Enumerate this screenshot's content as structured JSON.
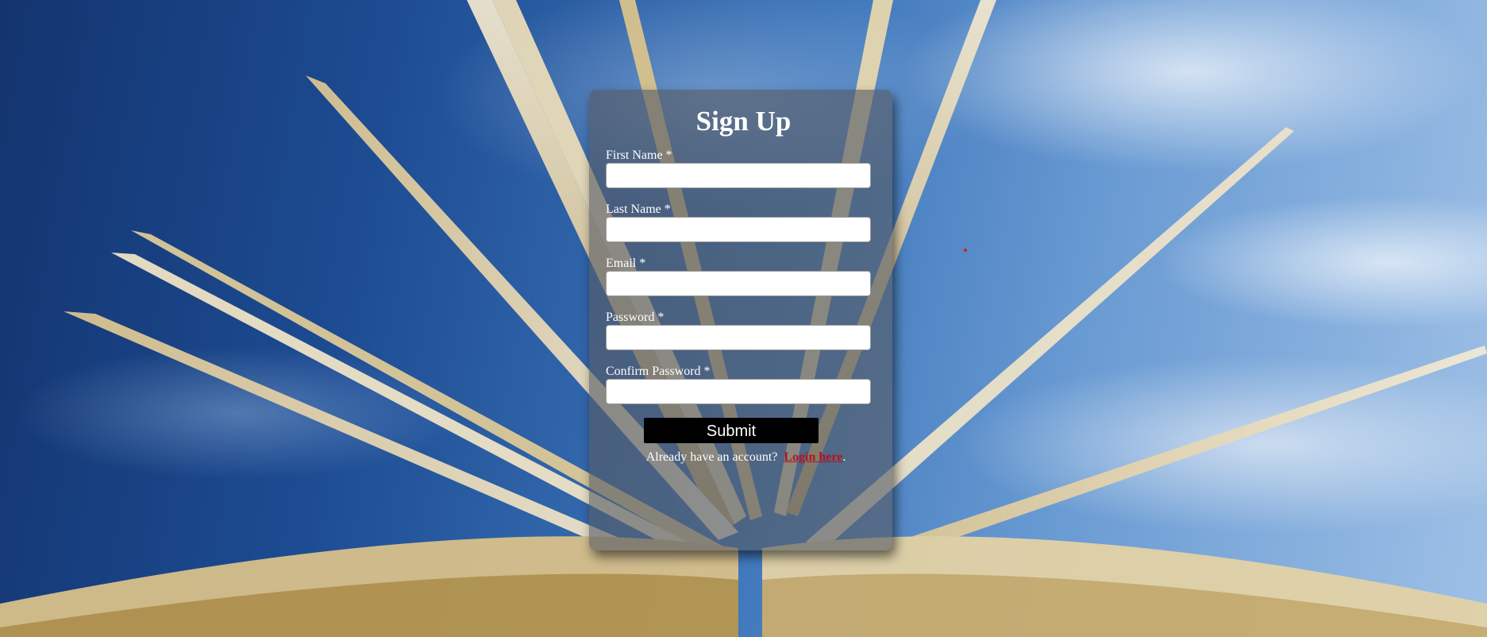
{
  "form": {
    "title": "Sign Up",
    "fields": [
      {
        "label": "First Name *",
        "value": ""
      },
      {
        "label": "Last Name *",
        "value": ""
      },
      {
        "label": "Email *",
        "value": ""
      },
      {
        "label": "Password *",
        "value": ""
      },
      {
        "label": "Confirm Password *",
        "value": ""
      }
    ],
    "submit_label": "Submit",
    "login_prompt": "Already have an account?",
    "login_link": "Login here",
    "login_suffix": "."
  },
  "colors": {
    "card_background": "#555a64",
    "submit_background": "#000000",
    "link": "#b3141c",
    "sky": "#3f77bb"
  }
}
